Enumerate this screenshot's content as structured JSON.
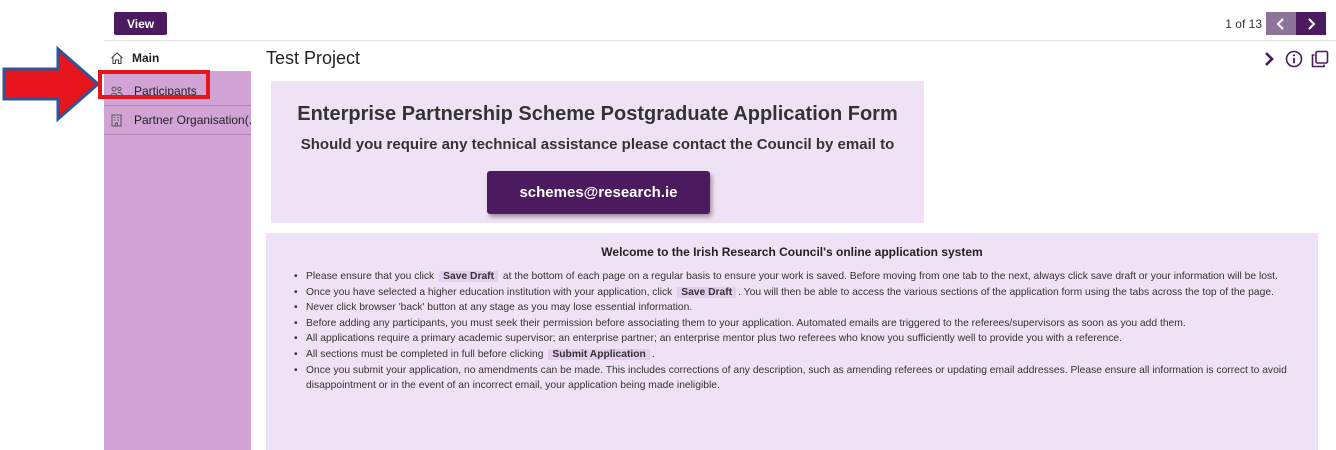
{
  "toolbar": {
    "view_label": "View",
    "pager_text": "1 of 13"
  },
  "sidebar": {
    "main_label": "Main",
    "items": [
      {
        "label": "Participants",
        "icon": "people-icon",
        "highlighted": true
      },
      {
        "label": "Partner Organisation(...",
        "icon": "building-icon"
      }
    ]
  },
  "page": {
    "title": "Test Project"
  },
  "banner": {
    "title": "Enterprise Partnership Scheme Postgraduate Application Form",
    "subtitle": "Should you require any technical assistance please contact the Council by email to",
    "email": "schemes@research.ie"
  },
  "welcome": {
    "heading": "Welcome to the Irish Research Council's online application system",
    "bullets": [
      {
        "before": "Please ensure that you click",
        "keyword": "Save Draft",
        "after": "at the bottom of each page on a regular basis to ensure your work is saved. Before moving from one tab to the next, always click save draft or your information will be lost."
      },
      {
        "before": "Once you have selected a higher education institution with your application, click",
        "keyword": "Save Draft",
        "after": ". You will then be able to access the various sections of the application form using the tabs across the top of the page."
      },
      {
        "text": "Never click browser 'back' button at any stage as you may lose essential information."
      },
      {
        "text": "Before adding any participants, you must seek their permission before associating them to your application. Automated emails are triggered to the referees/supervisors as soon as you add them."
      },
      {
        "text": "All applications require a primary academic supervisor; an enterprise partner; an enterprise mentor plus two referees who know you sufficiently well to provide you with a reference."
      },
      {
        "before": "All sections must be completed in full before clicking",
        "keyword": "Submit Application",
        "after": "."
      },
      {
        "text": "Once you submit your application, no amendments can be made. This includes corrections of any description, such as amending referees or updating email addresses. Please ensure all information is correct to avoid disappointment or in the event of an incorrect email, your application being made ineligible."
      }
    ]
  },
  "colors": {
    "brand_purple": "#4b1a5f",
    "sidebar_lilac": "#d1a4d5",
    "panel_lilac": "#f0e2f5",
    "annotation_red": "#e8141b",
    "arrow_blue": "#2e5597"
  }
}
